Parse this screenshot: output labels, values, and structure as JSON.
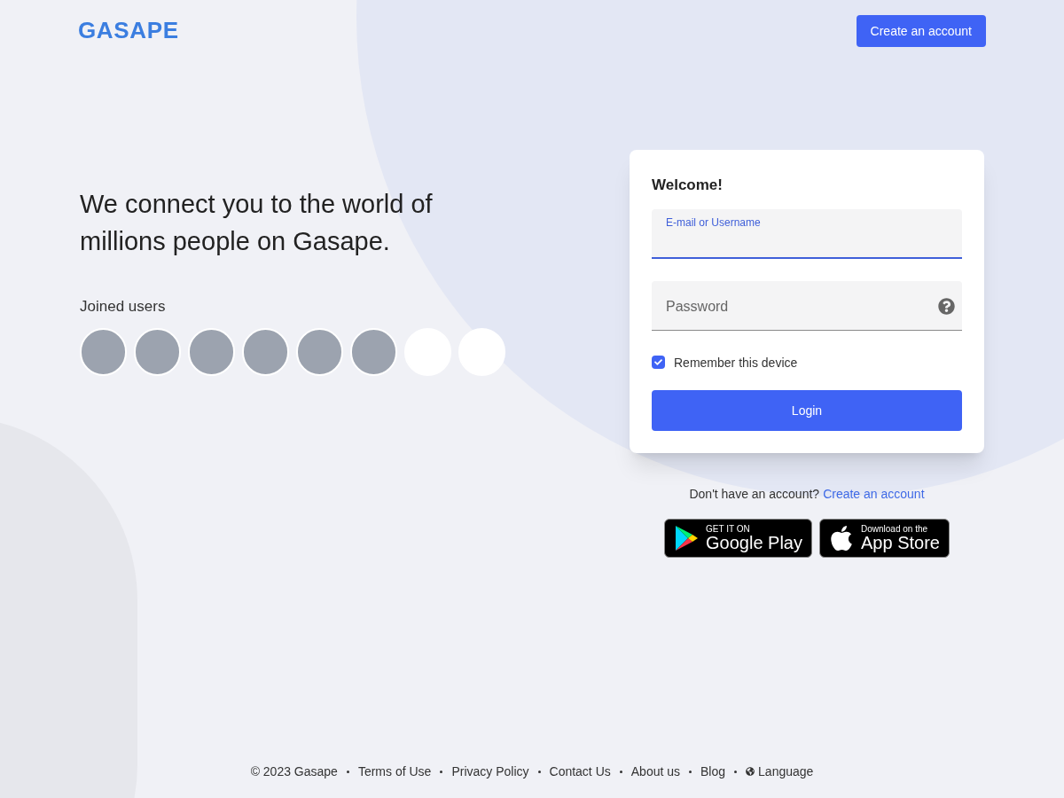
{
  "header": {
    "logo": "GASAPE",
    "create_account_button": "Create an account"
  },
  "hero": {
    "headline": "We connect you to the world of millions people on Gasape.",
    "joined_title": "Joined users",
    "avatars": [
      {
        "kind": "photo"
      },
      {
        "kind": "photo"
      },
      {
        "kind": "photo"
      },
      {
        "kind": "photo"
      },
      {
        "kind": "photo"
      },
      {
        "kind": "photo"
      },
      {
        "kind": "logo"
      },
      {
        "kind": "logo"
      }
    ]
  },
  "login": {
    "title": "Welcome!",
    "fields": [
      {
        "label": "E-mail or Username",
        "focused": true,
        "help": false
      },
      {
        "label": "Password",
        "focused": false,
        "help": true
      }
    ],
    "remember": {
      "label": "Remember this device",
      "checked": true
    },
    "button": "Login"
  },
  "signup": {
    "prompt": "Don't have an account?",
    "link": "Create an account"
  },
  "stores": [
    {
      "kind": "google",
      "small": "GET IT ON",
      "big": "Google Play"
    },
    {
      "kind": "apple",
      "small": "Download on the",
      "big": "App Store"
    }
  ],
  "footer": [
    {
      "kind": "text",
      "label": "© 2023 Gasape"
    },
    {
      "kind": "link",
      "label": "Terms of Use"
    },
    {
      "kind": "link",
      "label": "Privacy Policy"
    },
    {
      "kind": "link",
      "label": "Contact Us"
    },
    {
      "kind": "link",
      "label": "About us"
    },
    {
      "kind": "link",
      "label": "Blog"
    },
    {
      "kind": "language",
      "label": "Language"
    }
  ]
}
